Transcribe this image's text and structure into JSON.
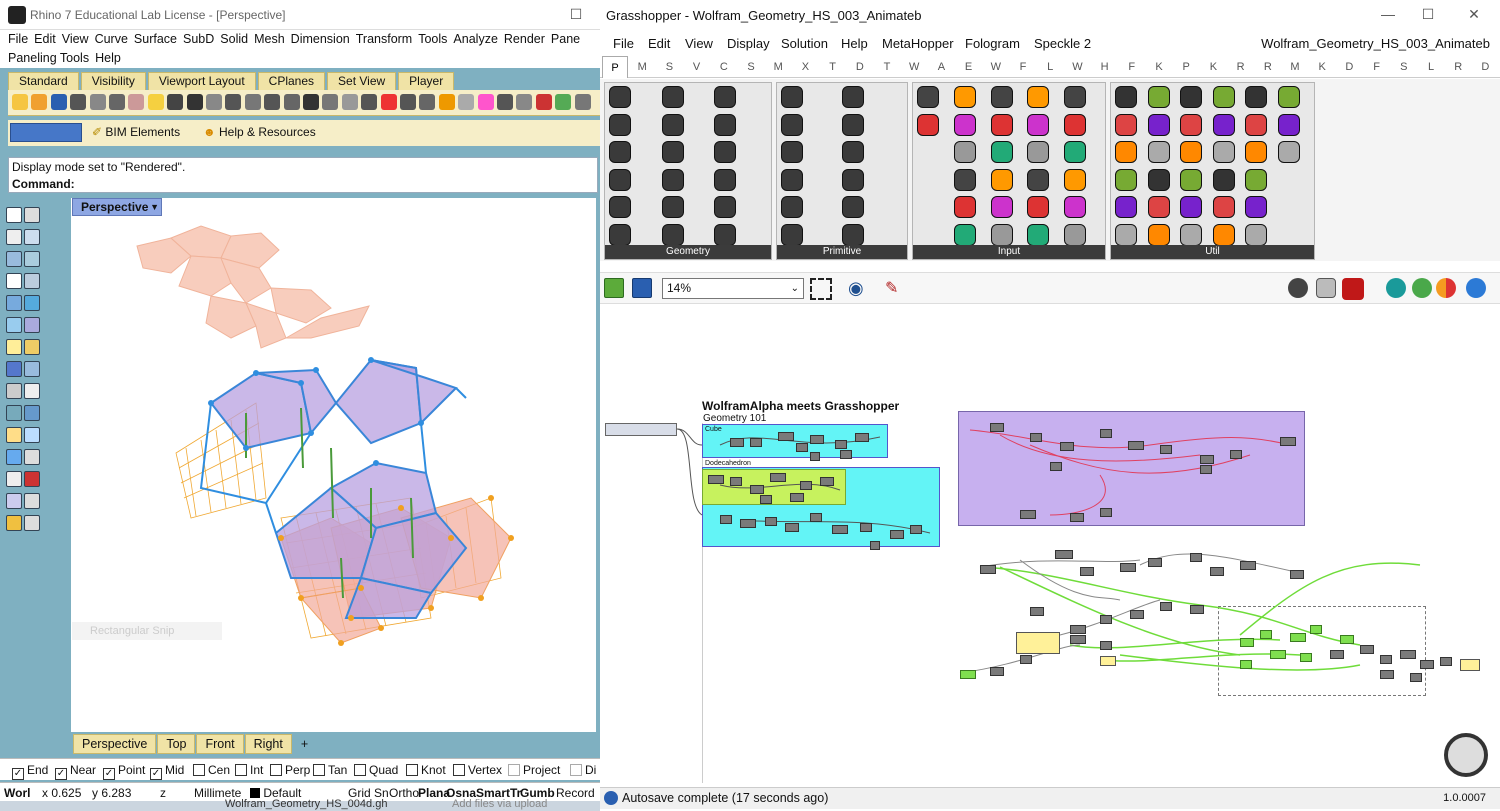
{
  "rhino": {
    "title": "Rhino 7 Educational Lab License - [Perspective]",
    "menu": [
      "File",
      "Edit",
      "View",
      "Curve",
      "Surface",
      "SubD",
      "Solid",
      "Mesh",
      "Dimension",
      "Transform",
      "Tools",
      "Analyze",
      "Render",
      "Pane"
    ],
    "menu2": [
      "Paneling Tools",
      "Help"
    ],
    "tabs": [
      "Standard",
      "Visibility",
      "Viewport Layout",
      "CPlanes",
      "Set View",
      "Player"
    ],
    "bim_label": "BIM Elements",
    "help_label": "Help & Resources",
    "command_history": "Display mode set to \"Rendered\".",
    "command_label": "Command:",
    "viewport_title": "Perspective",
    "snip_label": "Rectangular Snip",
    "view_tabs": [
      "Perspective",
      "Top",
      "Front",
      "Right"
    ],
    "add_tab": "+",
    "osnaps": [
      {
        "label": "End",
        "checked": true
      },
      {
        "label": "Near",
        "checked": true
      },
      {
        "label": "Point",
        "checked": true
      },
      {
        "label": "Mid",
        "checked": true
      },
      {
        "label": "Cen",
        "checked": false
      },
      {
        "label": "Int",
        "checked": false
      },
      {
        "label": "Perp",
        "checked": false
      },
      {
        "label": "Tan",
        "checked": false
      },
      {
        "label": "Quad",
        "checked": false
      },
      {
        "label": "Knot",
        "checked": false
      },
      {
        "label": "Vertex",
        "checked": false
      },
      {
        "label": "Project",
        "checked": false
      },
      {
        "label": "Di",
        "checked": false
      }
    ],
    "status": {
      "cplane": "Worl",
      "x": "x 0.625",
      "y": "y 6.283",
      "z": "z",
      "units": "Millimete",
      "layer": "Default",
      "grid": "Grid Sn",
      "ortho": "Ortho",
      "planar": "Plana",
      "osnap": "Osna",
      "smarttrack": "SmartTr",
      "gumball": "Gumb",
      "record": "Record"
    },
    "taskbar_left": "Wolfram_Geometry_HS_004d.gh",
    "taskbar_right": "Add files via upload"
  },
  "grasshopper": {
    "title": "Grasshopper - Wolfram_Geometry_HS_003_Animateb",
    "menu": [
      "File",
      "Edit",
      "View",
      "Display",
      "Solution",
      "Help",
      "MetaHopper",
      "Fologram",
      "Speckle 2"
    ],
    "file_name": "Wolfram_Geometry_HS_003_Animateb",
    "category_tabs": [
      "P",
      "M",
      "S",
      "V",
      "C",
      "S",
      "M",
      "X",
      "T",
      "D",
      "T",
      "W",
      "A",
      "E",
      "W",
      "F",
      "L",
      "W",
      "H",
      "F",
      "K",
      "P",
      "K",
      "R",
      "R",
      "M",
      "K",
      "D",
      "F",
      "S",
      "L",
      "R",
      "D"
    ],
    "panels": [
      "Geometry",
      "Primitive",
      "Input",
      "Util"
    ],
    "zoom": "14%",
    "group_title": "WolframAlpha meets Grasshopper",
    "group_subtitle": "Geometry 101",
    "cube_label": "Cube",
    "dodeca_label": "Dodecahedron",
    "autosave": "Autosave complete (17 seconds ago)",
    "version": "1.0.0007"
  },
  "colors": {
    "rhino_bg": "#7fb0c1",
    "tab": "#f0e3a6",
    "gh_cyan": "#63f4f6",
    "gh_purple": "#c7b0ef",
    "gh_lime": "#c7f25e"
  }
}
